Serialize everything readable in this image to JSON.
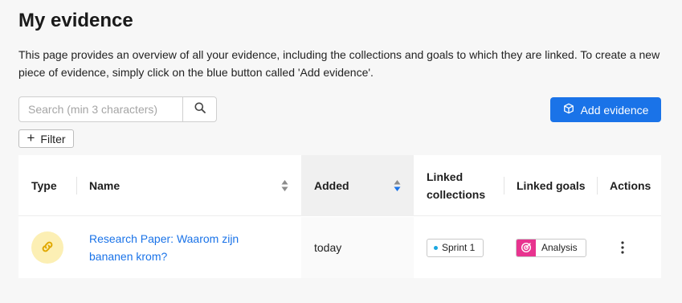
{
  "page": {
    "title": "My evidence",
    "description": "This page provides an overview of all your evidence, including the collections and goals to which they are linked. To create a new piece of evidence, simply click on the blue button called 'Add evidence'."
  },
  "search": {
    "placeholder": "Search (min 3 characters)",
    "value": ""
  },
  "toolbar": {
    "add_label": "Add evidence",
    "filter_label": "Filter"
  },
  "table": {
    "headers": {
      "type": "Type",
      "name": "Name",
      "added": "Added",
      "linked_collections": "Linked collections",
      "linked_goals": "Linked goals",
      "actions": "Actions"
    },
    "sorted_column": "added",
    "rows": [
      {
        "type_icon": "link-icon",
        "name": "Research Paper: Waarom zijn bananen krom?",
        "added": "today",
        "collection": "Sprint 1",
        "goal": "Analysis"
      }
    ]
  },
  "colors": {
    "primary": "#1a73e8",
    "goal_accent": "#e8338f",
    "collection_dot": "#1aa7e0",
    "type_badge_bg": "#fcefb4",
    "type_icon": "#e0a800"
  }
}
